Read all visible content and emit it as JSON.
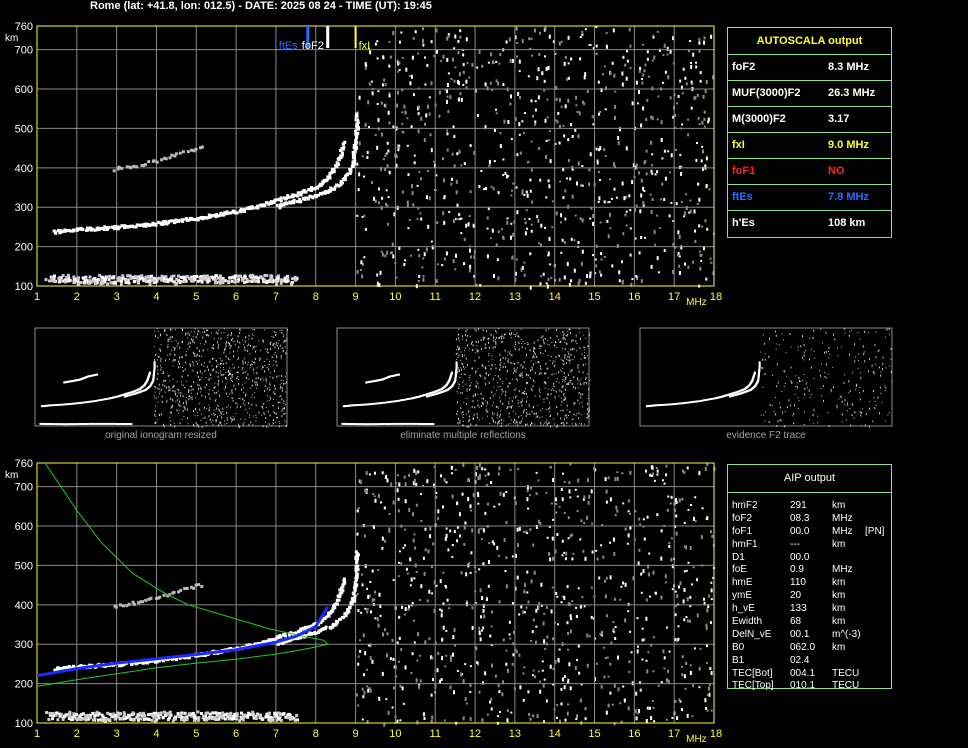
{
  "header": "Rome (lat: +41.8, lon: 012.5) - DATE: 2025 08 24 - TIME (UT): 19:45",
  "colors": {
    "grid": "#8a8a8a",
    "axis": "#ffff33",
    "frame": "#ffff33",
    "panel_border": "#8fe38f",
    "label_yellow": "#ffff33",
    "red": "#ff2222",
    "blue": "#2a6bff",
    "green": "#22cc22",
    "model": "#1c2cff"
  },
  "axes": {
    "km_unit": "km",
    "mhz_unit": "MHz",
    "y_ticks": [
      "760",
      "700",
      "600",
      "500",
      "400",
      "300",
      "200",
      "100"
    ],
    "x_ticks": [
      "1",
      "2",
      "3",
      "4",
      "5",
      "6",
      "7",
      "8",
      "9",
      "10",
      "11",
      "12",
      "13",
      "14",
      "15",
      "16",
      "17",
      "18"
    ]
  },
  "chart_data": {
    "type": "scatter",
    "xlabel": "MHz",
    "ylabel": "km",
    "xlim": [
      1,
      18
    ],
    "ylim": [
      100,
      760
    ],
    "grid": true,
    "markers": {
      "ftEs": "ftEs",
      "foF2": "foF2",
      "fxI": "fxI"
    },
    "trace_F2_O": [
      [
        1.4,
        240
      ],
      [
        2,
        246
      ],
      [
        3,
        252
      ],
      [
        4,
        262
      ],
      [
        5,
        275
      ],
      [
        6,
        293
      ],
      [
        6.5,
        305
      ],
      [
        7,
        320
      ],
      [
        7.5,
        336
      ],
      [
        8,
        355
      ],
      [
        8.3,
        380
      ],
      [
        8.5,
        410
      ],
      [
        8.6,
        440
      ],
      [
        8.7,
        470
      ]
    ],
    "trace_F2_X": [
      [
        7,
        305
      ],
      [
        7.6,
        322
      ],
      [
        8,
        335
      ],
      [
        8.4,
        350
      ],
      [
        8.7,
        375
      ],
      [
        8.9,
        410
      ],
      [
        8.95,
        450
      ],
      [
        9.0,
        500
      ],
      [
        9.0,
        540
      ]
    ],
    "trace_F2_multiple": [
      [
        2.9,
        400
      ],
      [
        3.5,
        410
      ],
      [
        4,
        420
      ],
      [
        4.5,
        440
      ],
      [
        5.2,
        455
      ]
    ],
    "trace_Es": [
      [
        1.3,
        121
      ],
      [
        2,
        120
      ],
      [
        3,
        119
      ],
      [
        4,
        120
      ],
      [
        5,
        121
      ],
      [
        6,
        121
      ],
      [
        7,
        120
      ],
      [
        7.5,
        120
      ]
    ],
    "aip_green_profile": [
      [
        1.0,
        193
      ],
      [
        2,
        210
      ],
      [
        3,
        225
      ],
      [
        4,
        240
      ],
      [
        5,
        252
      ],
      [
        6,
        262
      ],
      [
        7,
        275
      ],
      [
        7.6,
        285
      ],
      [
        8.0,
        293
      ],
      [
        8.3,
        300
      ],
      [
        8.2,
        310
      ],
      [
        7.6,
        322
      ],
      [
        6.8,
        340
      ],
      [
        5.8,
        370
      ],
      [
        4.8,
        400
      ],
      [
        4.2,
        430
      ],
      [
        3.4,
        480
      ],
      [
        2.6,
        560
      ],
      [
        2.0,
        640
      ],
      [
        1.6,
        700
      ],
      [
        1.2,
        760
      ]
    ],
    "aip_blue_model": [
      [
        1.0,
        220
      ],
      [
        2,
        238
      ],
      [
        3,
        252
      ],
      [
        4,
        263
      ],
      [
        5,
        274
      ],
      [
        6,
        286
      ],
      [
        7,
        305
      ],
      [
        7.5,
        320
      ],
      [
        8.0,
        345
      ],
      [
        8.3,
        395
      ]
    ]
  },
  "autoscala": {
    "title": "AUTOSCALA output",
    "rows": [
      {
        "label": "foF2",
        "value": "8.3 MHz",
        "color": "#ffffff"
      },
      {
        "label": "MUF(3000)F2",
        "value": "26.3 MHz",
        "color": "#ffffff"
      },
      {
        "label": "M(3000)F2",
        "value": "3.17",
        "color": "#ffffff"
      },
      {
        "label": "fxI",
        "value": "9.0 MHz",
        "color": "#ffff33"
      },
      {
        "label": "foF1",
        "value": "NO",
        "color": "#ff2222"
      },
      {
        "label": "ftEs",
        "value": "7.8 MHz",
        "color": "#2a6bff"
      },
      {
        "label": "h'Es",
        "value": "108     km",
        "color": "#ffffff"
      }
    ]
  },
  "thumbnails": [
    {
      "caption": "original ionogram resized"
    },
    {
      "caption": "eliminate multiple reflections"
    },
    {
      "caption": "evidence F2 trace"
    }
  ],
  "aip": {
    "title": "AIP output",
    "rows": [
      {
        "name": "hmF2",
        "value": "291",
        "unit": "km",
        "extra": ""
      },
      {
        "name": "foF2",
        "value": "08.3",
        "unit": "MHz",
        "extra": ""
      },
      {
        "name": "foF1",
        "value": "00.0",
        "unit": "MHz",
        "extra": "[PN]"
      },
      {
        "name": "hmF1",
        "value": "---",
        "unit": "km",
        "extra": ""
      },
      {
        "name": "D1",
        "value": "00.0",
        "unit": "",
        "extra": ""
      },
      {
        "name": "foE",
        "value": "0.9",
        "unit": "MHz",
        "extra": ""
      },
      {
        "name": "hmE",
        "value": "110",
        "unit": "km",
        "extra": ""
      },
      {
        "name": "ymE",
        "value": "20",
        "unit": "km",
        "extra": ""
      },
      {
        "name": "h_vE",
        "value": "133",
        "unit": "km",
        "extra": ""
      },
      {
        "name": "Ewidth",
        "value": "68",
        "unit": "km",
        "extra": ""
      },
      {
        "name": "DelN_vE",
        "value": "00.1",
        "unit": "m^(-3)",
        "extra": ""
      },
      {
        "name": "B0",
        "value": "062.0",
        "unit": "km",
        "extra": ""
      },
      {
        "name": "B1",
        "value": "02.4",
        "unit": "",
        "extra": ""
      },
      {
        "name": "TEC[Bot]",
        "value": "004.1",
        "unit": "TECU",
        "extra": ""
      },
      {
        "name": "TEC[Top]",
        "value": "010.1",
        "unit": "TECU",
        "extra": ""
      }
    ]
  }
}
